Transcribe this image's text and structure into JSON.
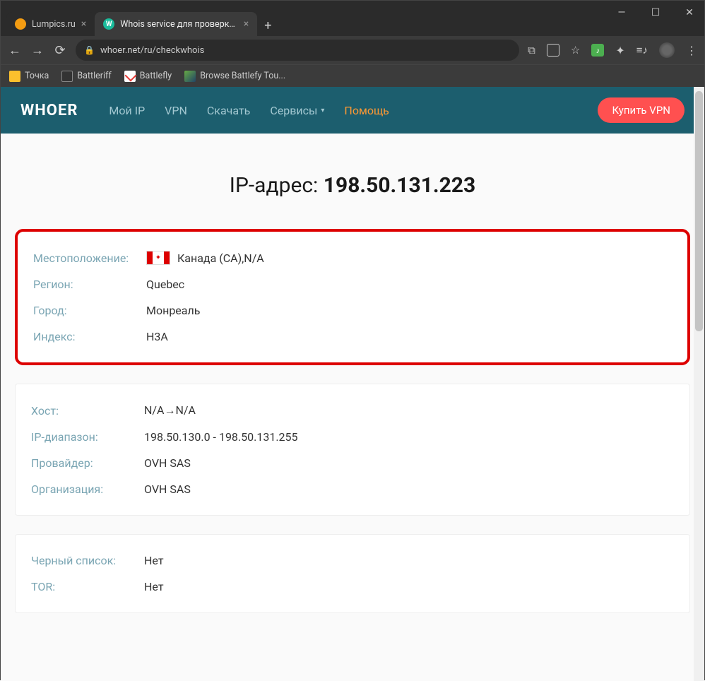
{
  "browser": {
    "tabs": [
      {
        "title": "Lumpics.ru",
        "active": false
      },
      {
        "title": "Whois service для проверки дом",
        "active": true,
        "favicon_letter": "W"
      }
    ],
    "url": "whoer.net/ru/checkwhois",
    "bookmarks": [
      {
        "label": "Точка"
      },
      {
        "label": "Battleriff"
      },
      {
        "label": "Battlefly"
      },
      {
        "label": "Browse Battlefy Tou..."
      }
    ]
  },
  "site": {
    "logo": "WHOER",
    "nav": {
      "my_ip": "Мой IP",
      "vpn": "VPN",
      "download": "Скачать",
      "services": "Сервисы",
      "help": "Помощь"
    },
    "buy_button": "Купить VPN"
  },
  "main": {
    "title_prefix": "IP-адрес: ",
    "ip": "198.50.131.223",
    "location_panel": {
      "location_label": "Местоположение:",
      "location_value": "Канада (CA),N/A",
      "region_label": "Регион:",
      "region_value": "Quebec",
      "city_label": "Город:",
      "city_value": "Монреаль",
      "index_label": "Индекс:",
      "index_value": "H3A"
    },
    "host_panel": {
      "host_label": "Хост:",
      "host_value": "N/A→N/A",
      "range_label": "IP-диапазон:",
      "range_value": "198.50.130.0 - 198.50.131.255",
      "provider_label": "Провайдер:",
      "provider_value": "OVH SAS",
      "org_label": "Организация:",
      "org_value": "OVH SAS"
    },
    "blacklist_panel": {
      "blacklist_label": "Черный список:",
      "blacklist_value": "Нет",
      "tor_label": "TOR:",
      "tor_value": "Нет"
    }
  }
}
